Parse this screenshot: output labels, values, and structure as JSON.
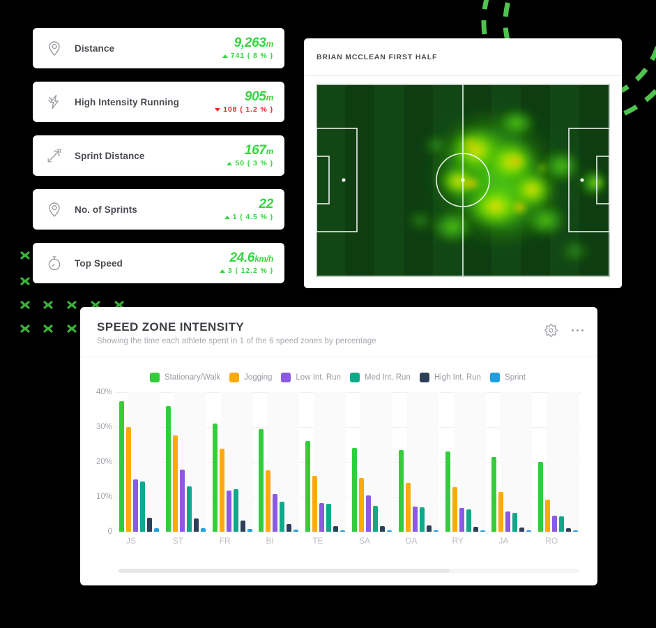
{
  "theme": {
    "accent_green": "#35d63f",
    "danger_red": "#f4212e",
    "card_bg": "#ffffff",
    "page_bg": "#000000"
  },
  "stats": {
    "cards": [
      {
        "icon": "map-pin-icon",
        "label": "Distance",
        "value": "9,263",
        "unit": "m",
        "delta": "741 ( 8 % )",
        "direction": "up"
      },
      {
        "icon": "lightning-bolt-icon",
        "label": "High Intensity Running",
        "value": "905",
        "unit": "m",
        "delta": "108 ( 1.2 % )",
        "direction": "down"
      },
      {
        "icon": "diagonal-arrow-icon",
        "label": "Sprint Distance",
        "value": "167",
        "unit": "m",
        "delta": "50 ( 3 % )",
        "direction": "up"
      },
      {
        "icon": "map-pin-icon",
        "label": "No. of Sprints",
        "value": "22",
        "unit": "",
        "delta": "1 ( 4.5 % )",
        "direction": "up"
      },
      {
        "icon": "stopwatch-icon",
        "label": "Top Speed",
        "value": "24.6",
        "unit": "km/h",
        "delta": "3 ( 12.2 % )",
        "direction": "up"
      }
    ]
  },
  "heatmap": {
    "title": "BRIAN MCCLEAN FIRST HALF"
  },
  "speed_zone": {
    "title": "SPEED ZONE INTENSITY",
    "subtitle": "Showing the time each athlete spent in 1 of the 6 speed zones by percentage",
    "settings_icon": "gear-icon",
    "more_icon": "ellipsis-icon",
    "scroll_percent": 72
  },
  "chart_data": {
    "type": "bar",
    "title": "SPEED ZONE INTENSITY",
    "xlabel": "",
    "ylabel": "",
    "ylim": [
      0,
      40
    ],
    "grid": true,
    "legend_position": "top",
    "tick_labels": [
      "0",
      "10%",
      "20%",
      "30%",
      "40%"
    ],
    "tick_values": [
      0,
      10,
      20,
      30,
      40
    ],
    "categories": [
      "JS",
      "ST",
      "FR",
      "BI",
      "TE",
      "SA",
      "DA",
      "RY",
      "JA",
      "RO"
    ],
    "series": [
      {
        "name": "Stationary/Walk",
        "color": "#35cc3c",
        "values": [
          37.5,
          36.0,
          31.0,
          29.5,
          26.0,
          24.0,
          23.5,
          23.0,
          21.5,
          20.0
        ]
      },
      {
        "name": "Jogging",
        "color": "#ffa90a",
        "values": [
          30.0,
          27.7,
          23.8,
          17.6,
          16.0,
          15.5,
          14.0,
          12.8,
          11.5,
          9.2
        ]
      },
      {
        "name": "Low Int. Run",
        "color": "#8a5ae0",
        "values": [
          15.0,
          17.8,
          11.8,
          10.8,
          8.2,
          10.5,
          7.2,
          6.8,
          5.8,
          4.6
        ]
      },
      {
        "name": "Med Int. Run",
        "color": "#0fa98a",
        "values": [
          14.5,
          13.0,
          12.3,
          8.6,
          8.0,
          7.5,
          7.0,
          6.5,
          5.5,
          4.5
        ]
      },
      {
        "name": "High Int. Run",
        "color": "#2e4057",
        "values": [
          4.0,
          3.8,
          3.2,
          2.3,
          1.6,
          1.7,
          1.8,
          1.5,
          1.2,
          1.0
        ]
      },
      {
        "name": "Sprint",
        "color": "#1f9fe0",
        "values": [
          1.1,
          1.0,
          0.8,
          0.7,
          0.5,
          0.5,
          0.5,
          0.5,
          0.4,
          0.3
        ]
      }
    ]
  }
}
